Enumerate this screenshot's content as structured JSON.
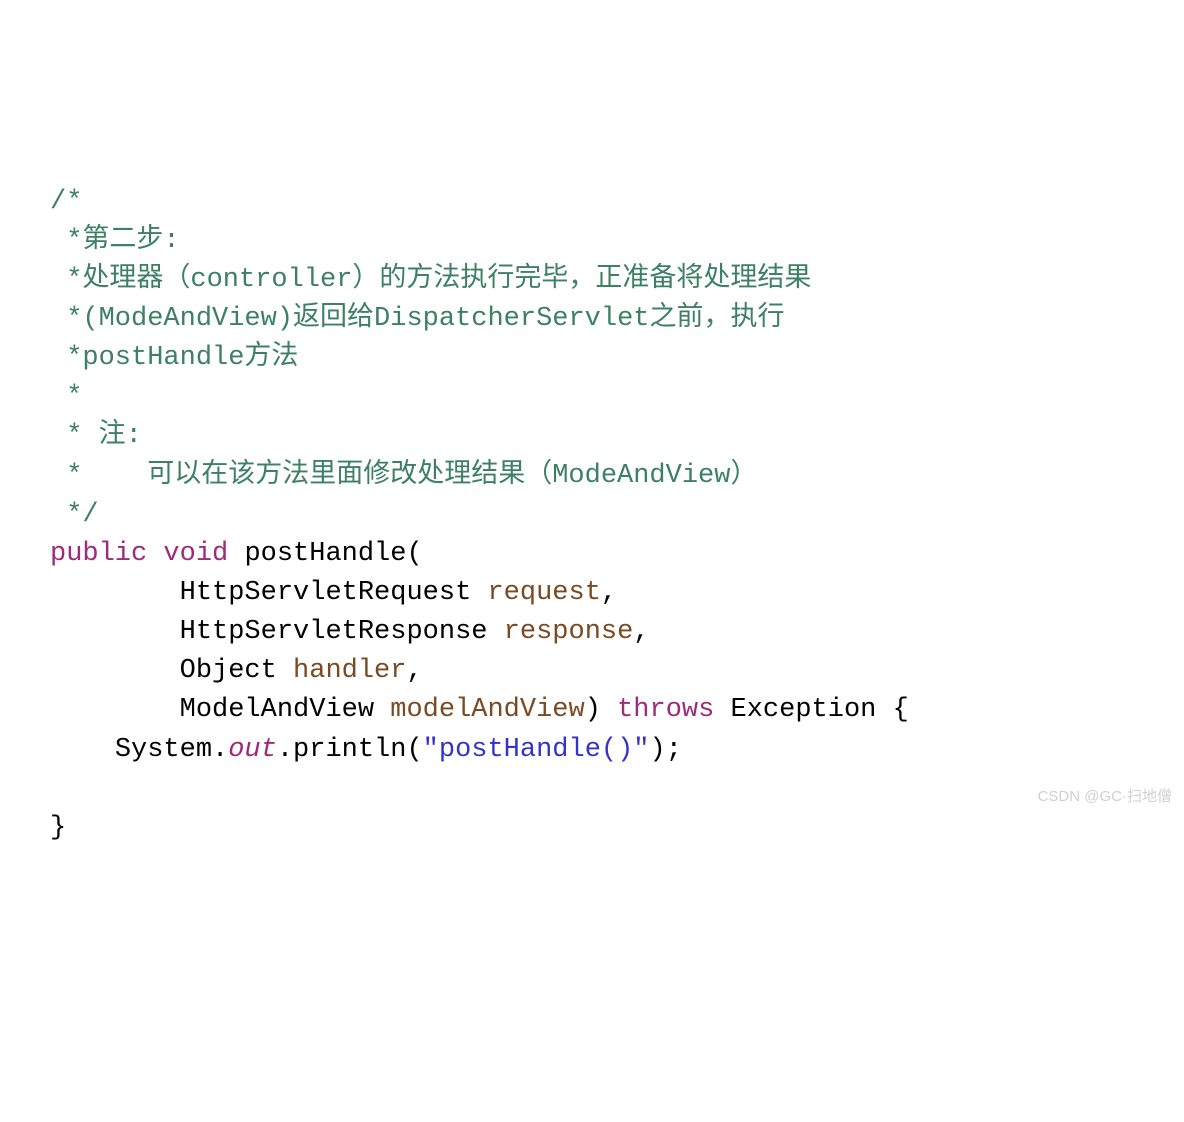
{
  "code": {
    "c1": "/*",
    "c2": " *第二步:",
    "c3": " *处理器（controller）的方法执行完毕，正准备将处理结果",
    "c4": " *(ModeAndView)返回给DispatcherServlet之前，执行",
    "c5": " *postHandle方法",
    "c6": " *",
    "c7": " * 注:",
    "c8": " *    可以在该方法里面修改处理结果（ModeAndView）",
    "c9": " */",
    "kw_public": "public",
    "kw_void": "void",
    "method_name": "postHandle",
    "paren_open": "(",
    "type1": "HttpServletRequest",
    "param1": "request",
    "comma": ",",
    "type2": "HttpServletResponse",
    "param2": "response",
    "type3": "Object",
    "param3": "handler",
    "type4": "ModelAndView",
    "param4": "modelAndView",
    "paren_close": ")",
    "kw_throws": "throws",
    "exception": "Exception",
    "brace_open": "{",
    "sys": "System",
    "dot": ".",
    "out": "out",
    "println": "println",
    "paren_open2": "(",
    "str": "\"postHandle()\"",
    "paren_close_semi": ");",
    "brace_close": "}"
  },
  "watermark": "CSDN @GC·扫地僧"
}
